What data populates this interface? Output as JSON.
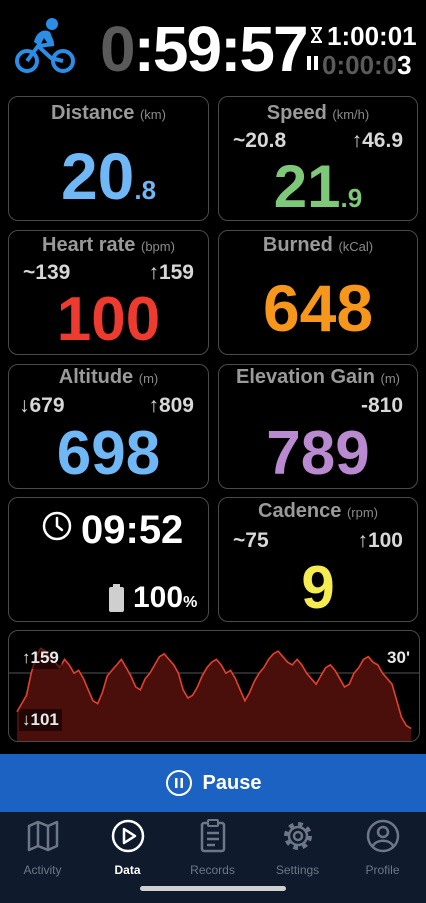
{
  "header": {
    "elapsed_dim": "0",
    "elapsed_sep": ":",
    "elapsed": "59:57",
    "total_time": "1:00:01",
    "paused_time_dim": "0:00:0",
    "paused_time": "3"
  },
  "cards": {
    "distance": {
      "title": "Distance",
      "unit": "(km)",
      "int": "20",
      "frac": ".8",
      "color": "#6fb7f5"
    },
    "speed": {
      "title": "Speed",
      "unit": "(km/h)",
      "avg": "~20.8",
      "max": "↑46.9",
      "int": "21",
      "frac": ".9",
      "color": "#7ec87a"
    },
    "heart": {
      "title": "Heart rate",
      "unit": "(bpm)",
      "avg": "~139",
      "max": "↑159",
      "value": "100",
      "color": "#ee3b2f"
    },
    "burned": {
      "title": "Burned",
      "unit": "(kCal)",
      "value": "648",
      "color": "#f6961a"
    },
    "altitude": {
      "title": "Altitude",
      "unit": "(m)",
      "min": "↓679",
      "max": "↑809",
      "value": "698",
      "color": "#6fb7f5"
    },
    "elevation": {
      "title": "Elevation Gain",
      "unit": "(m)",
      "loss": "-810",
      "value": "789",
      "color": "#b98ad0"
    },
    "clock": {
      "time": "09:52",
      "battery": "100",
      "battery_unit": "%"
    },
    "cadence": {
      "title": "Cadence",
      "unit": "(rpm)",
      "avg": "~75",
      "max": "↑100",
      "value": "9",
      "color": "#f5ec52"
    }
  },
  "chart": {
    "max_label": "↑159",
    "min_label": "↓101",
    "duration_label": "30'",
    "line_color": "#e2412f",
    "y_range": [
      101,
      159
    ],
    "hr_samples": [
      112,
      118,
      124,
      140,
      152,
      158,
      156,
      150,
      148,
      144,
      150,
      146,
      140,
      142,
      136,
      128,
      120,
      118,
      126,
      138,
      142,
      146,
      150,
      144,
      138,
      130,
      128,
      136,
      140,
      146,
      152,
      154,
      150,
      146,
      140,
      128,
      122,
      124,
      130,
      138,
      144,
      148,
      150,
      146,
      140,
      142,
      136,
      128,
      120,
      126,
      134,
      140,
      144,
      150,
      154,
      156,
      152,
      148,
      146,
      150,
      146,
      140,
      136,
      132,
      138,
      144,
      146,
      142,
      136,
      130,
      132,
      140,
      144,
      150,
      152,
      148,
      146,
      140,
      136,
      132,
      120,
      108,
      102,
      100
    ]
  },
  "pause": {
    "label": "Pause"
  },
  "nav": {
    "items": [
      {
        "label": "Activity"
      },
      {
        "label": "Data"
      },
      {
        "label": "Records"
      },
      {
        "label": "Settings"
      },
      {
        "label": "Profile"
      }
    ]
  }
}
